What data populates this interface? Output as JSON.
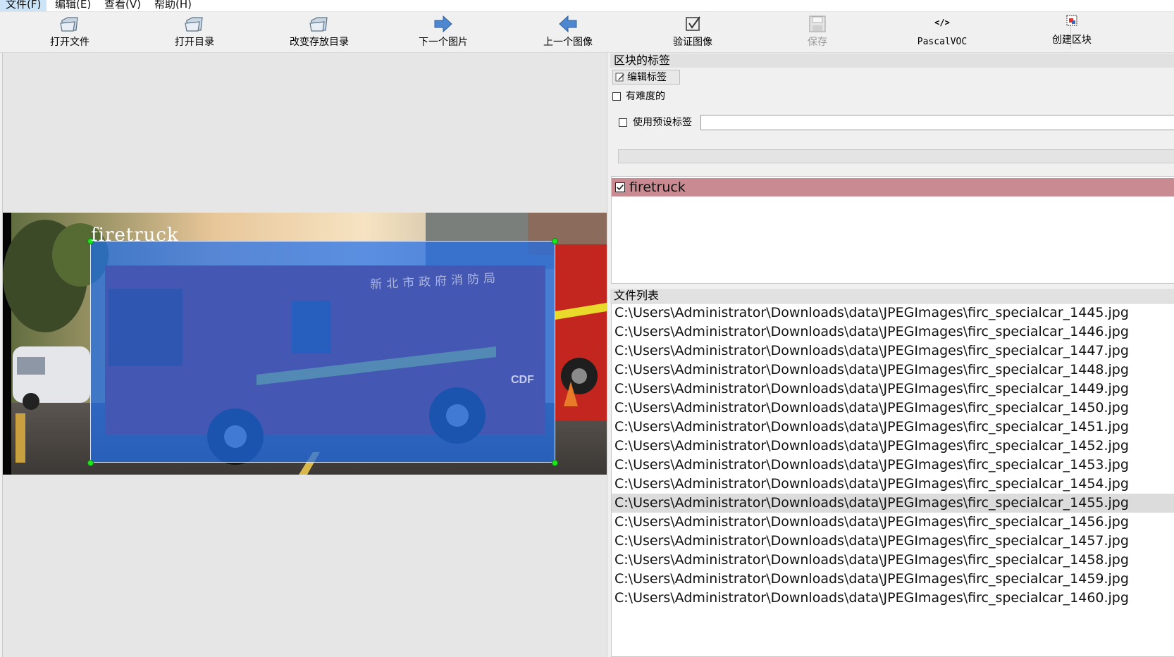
{
  "menu": [
    "文件(F)",
    "编辑(E)",
    "查看(V)",
    "帮助(H)"
  ],
  "toolbar": {
    "open_file": "打开文件",
    "open_dir": "打开目录",
    "change_save_dir": "改变存放目录",
    "next_image": "下一个图片",
    "prev_image": "上一个图像",
    "verify_image": "验证图像",
    "save": "保存",
    "format": "PascalVOC",
    "format_icon": "</>",
    "create_box": "创建区块"
  },
  "canvas": {
    "box_label": "firetruck",
    "truck_door_text": "新北市政府消防局",
    "truck_brand": "CDF"
  },
  "box_labels_panel": {
    "title": "区块的标签",
    "edit_label_button": "编辑标签",
    "difficult_label": "有难度的",
    "use_default_label": "使用预设标签",
    "default_label_value": ""
  },
  "label_list": [
    {
      "label": "firetruck",
      "checked": true
    }
  ],
  "file_list_panel": {
    "title": "文件列表",
    "selected_index": 10,
    "files": [
      "C:\\Users\\Administrator\\Downloads\\data\\JPEGImages\\firc_specialcar_1445.jpg",
      "C:\\Users\\Administrator\\Downloads\\data\\JPEGImages\\firc_specialcar_1446.jpg",
      "C:\\Users\\Administrator\\Downloads\\data\\JPEGImages\\firc_specialcar_1447.jpg",
      "C:\\Users\\Administrator\\Downloads\\data\\JPEGImages\\firc_specialcar_1448.jpg",
      "C:\\Users\\Administrator\\Downloads\\data\\JPEGImages\\firc_specialcar_1449.jpg",
      "C:\\Users\\Administrator\\Downloads\\data\\JPEGImages\\firc_specialcar_1450.jpg",
      "C:\\Users\\Administrator\\Downloads\\data\\JPEGImages\\firc_specialcar_1451.jpg",
      "C:\\Users\\Administrator\\Downloads\\data\\JPEGImages\\firc_specialcar_1452.jpg",
      "C:\\Users\\Administrator\\Downloads\\data\\JPEGImages\\firc_specialcar_1453.jpg",
      "C:\\Users\\Administrator\\Downloads\\data\\JPEGImages\\firc_specialcar_1454.jpg",
      "C:\\Users\\Administrator\\Downloads\\data\\JPEGImages\\firc_specialcar_1455.jpg",
      "C:\\Users\\Administrator\\Downloads\\data\\JPEGImages\\firc_specialcar_1456.jpg",
      "C:\\Users\\Administrator\\Downloads\\data\\JPEGImages\\firc_specialcar_1457.jpg",
      "C:\\Users\\Administrator\\Downloads\\data\\JPEGImages\\firc_specialcar_1458.jpg",
      "C:\\Users\\Administrator\\Downloads\\data\\JPEGImages\\firc_specialcar_1459.jpg",
      "C:\\Users\\Administrator\\Downloads\\data\\JPEGImages\\firc_specialcar_1460.jpg"
    ]
  },
  "colors": {
    "selection_box": "#1e6eeb",
    "label_item_bg": "#c98a92",
    "handle": "#1ee61e"
  }
}
